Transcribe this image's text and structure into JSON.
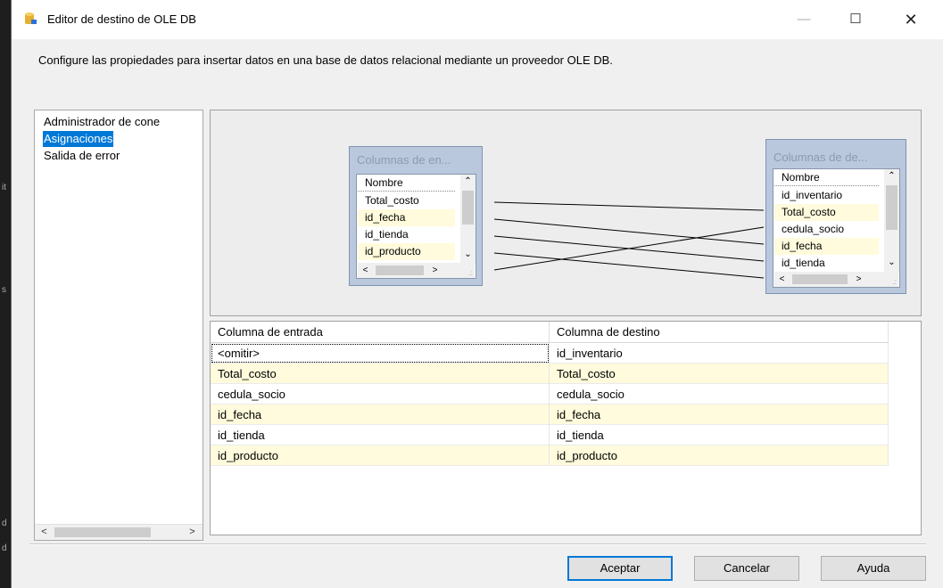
{
  "window": {
    "title": "Editor de destino de OLE DB",
    "controls": {
      "minimize": "—",
      "maximize": "☐",
      "close": "✕"
    }
  },
  "description": "Configure las propiedades para insertar datos en una base de datos relacional mediante un proveedor OLE DB.",
  "nav": {
    "items": [
      {
        "label": "Administrador de cone",
        "selected": false
      },
      {
        "label": "Asignaciones",
        "selected": true
      },
      {
        "label": "Salida de error",
        "selected": false
      }
    ],
    "scroll_left": "<",
    "scroll_right": ">"
  },
  "input_box": {
    "title": "Columnas de en...",
    "header": "Nombre",
    "columns": [
      "Total_costo",
      "id_fecha",
      "id_tienda",
      "id_producto"
    ]
  },
  "dest_box": {
    "title": "Columnas de de...",
    "header": "Nombre",
    "columns": [
      "id_inventario",
      "Total_costo",
      "cedula_socio",
      "id_fecha",
      "id_tienda"
    ]
  },
  "grid": {
    "headers": [
      "Columna de entrada",
      "Columna de destino"
    ],
    "rows": [
      {
        "input": "<omitir>",
        "dest": "id_inventario"
      },
      {
        "input": "Total_costo",
        "dest": "Total_costo"
      },
      {
        "input": "cedula_socio",
        "dest": "cedula_socio"
      },
      {
        "input": "id_fecha",
        "dest": "id_fecha"
      },
      {
        "input": "id_tienda",
        "dest": "id_tienda"
      },
      {
        "input": "id_producto",
        "dest": "id_producto"
      }
    ]
  },
  "buttons": {
    "ok": "Aceptar",
    "cancel": "Cancelar",
    "help": "Ayuda"
  },
  "colors": {
    "selection": "#0078d7",
    "mapped_row": "#fffbdc",
    "box_frame": "#b9c8dd"
  },
  "icons": {
    "title": "ole-db-destination-icon",
    "scroll_up": "▲",
    "scroll_down": "▼"
  }
}
